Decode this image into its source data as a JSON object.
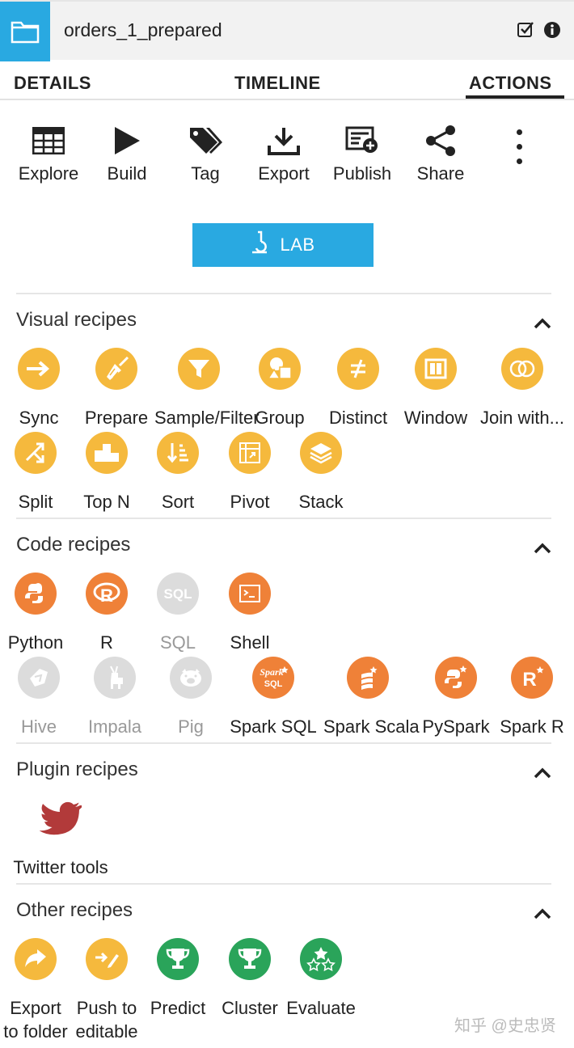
{
  "header": {
    "title": "orders_1_prepared",
    "accent_color": "#29a9e1"
  },
  "tabs": [
    {
      "label": "DETAILS"
    },
    {
      "label": "TIMELINE"
    },
    {
      "label": "ACTIONS",
      "active": true
    }
  ],
  "toolbar": {
    "items": [
      {
        "label": "Explore",
        "icon": "table-icon"
      },
      {
        "label": "Build",
        "icon": "play-icon"
      },
      {
        "label": "Tag",
        "icon": "tag-icon"
      },
      {
        "label": "Export",
        "icon": "download-icon"
      },
      {
        "label": "Publish",
        "icon": "publish-icon"
      },
      {
        "label": "Share",
        "icon": "share-icon"
      }
    ]
  },
  "lab": {
    "label": "LAB"
  },
  "sections": {
    "visual": {
      "title": "Visual recipes",
      "items": [
        {
          "label": "Sync"
        },
        {
          "label": "Prepare"
        },
        {
          "label": "Sample/Filter"
        },
        {
          "label": "Group"
        },
        {
          "label": "Distinct"
        },
        {
          "label": "Window"
        },
        {
          "label": "Join with..."
        },
        {
          "label": "Split"
        },
        {
          "label": "Top N"
        },
        {
          "label": "Sort"
        },
        {
          "label": "Pivot"
        },
        {
          "label": "Stack"
        }
      ]
    },
    "code": {
      "title": "Code recipes",
      "items": [
        {
          "label": "Python"
        },
        {
          "label": "R"
        },
        {
          "label": "SQL"
        },
        {
          "label": "Shell"
        },
        {
          "label": "Hive"
        },
        {
          "label": "Impala"
        },
        {
          "label": "Pig"
        },
        {
          "label": "Spark SQL"
        },
        {
          "label": "Spark Scala"
        },
        {
          "label": "PySpark"
        },
        {
          "label": "Spark R"
        }
      ]
    },
    "plugin": {
      "title": "Plugin recipes",
      "items": [
        {
          "label": "Twitter tools"
        }
      ]
    },
    "other": {
      "title": "Other recipes",
      "items": [
        {
          "label": "Export",
          "label2": "to folder"
        },
        {
          "label": "Push to",
          "label2": "editable"
        },
        {
          "label": "Predict"
        },
        {
          "label": "Cluster"
        },
        {
          "label": "Evaluate"
        }
      ]
    }
  },
  "colors": {
    "visual": "#f5b93d",
    "code": "#ef8138",
    "disabled": "#dcdcdc",
    "plugin": "#b23a3a",
    "ml": "#2aa45a"
  },
  "watermark": "知乎 @史忠贤"
}
